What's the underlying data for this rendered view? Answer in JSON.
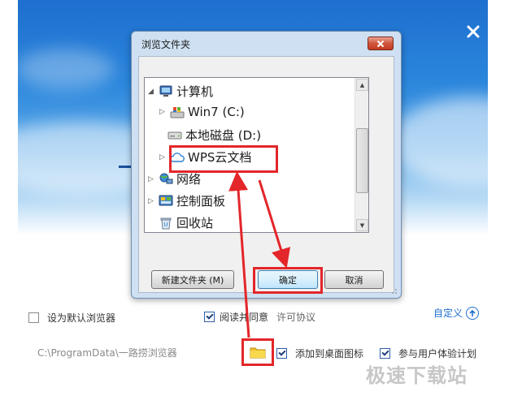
{
  "background": {
    "path_text": "C:\\ProgramData\\一路捞浏览器",
    "options": {
      "set_default_browser": "设为默认浏览器",
      "read_agree": "阅读并同意",
      "license": "许可协议",
      "customize": "自定义",
      "add_desktop_icon": "添加到桌面图标",
      "join_ux_plan": "参与用户体验计划"
    },
    "watermark": "极速下载站"
  },
  "dialog": {
    "title": "浏览文件夹",
    "tree": [
      {
        "label": "计算机",
        "icon": "computer-icon"
      },
      {
        "label": "Win7 (C:)",
        "icon": "windows-drive-icon"
      },
      {
        "label": "本地磁盘 (D:)",
        "icon": "hard-drive-icon"
      },
      {
        "label": "WPS云文档",
        "icon": "cloud-icon"
      },
      {
        "label": "网络",
        "icon": "network-icon"
      },
      {
        "label": "控制面板",
        "icon": "control-panel-icon"
      },
      {
        "label": "回收站",
        "icon": "recycle-bin-icon"
      }
    ],
    "buttons": {
      "new_folder": "新建文件夹 (M)",
      "ok": "确定",
      "cancel": "取消"
    }
  },
  "colors": {
    "highlight": "#e3262a",
    "accent": "#1e6fcf"
  }
}
